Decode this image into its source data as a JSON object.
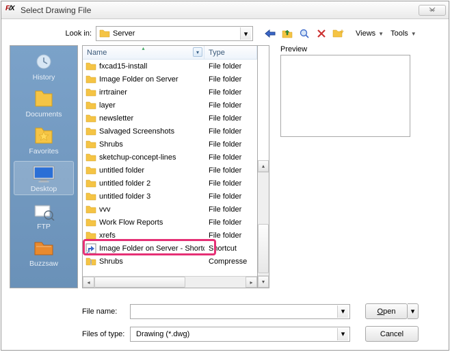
{
  "title": "Select Drawing File",
  "look_in": {
    "label": "Look in:",
    "value": "Server"
  },
  "toolbar_menus": {
    "views": "Views",
    "tools": "Tools"
  },
  "places": [
    {
      "key": "history",
      "label": "History"
    },
    {
      "key": "documents",
      "label": "Documents"
    },
    {
      "key": "favorites",
      "label": "Favorites"
    },
    {
      "key": "desktop",
      "label": "Desktop",
      "selected": true
    },
    {
      "key": "ftp",
      "label": "FTP"
    },
    {
      "key": "buzzsaw",
      "label": "Buzzsaw"
    }
  ],
  "columns": {
    "name": "Name",
    "type": "Type"
  },
  "files": [
    {
      "icon": "folder",
      "name": "fxcad15-install",
      "type": "File folder"
    },
    {
      "icon": "folder",
      "name": "Image Folder on Server",
      "type": "File folder"
    },
    {
      "icon": "folder",
      "name": "irrtrainer",
      "type": "File folder"
    },
    {
      "icon": "folder",
      "name": "layer",
      "type": "File folder"
    },
    {
      "icon": "folder",
      "name": "newsletter",
      "type": "File folder"
    },
    {
      "icon": "folder",
      "name": "Salvaged Screenshots",
      "type": "File folder"
    },
    {
      "icon": "folder",
      "name": "Shrubs",
      "type": "File folder"
    },
    {
      "icon": "folder",
      "name": "sketchup-concept-lines",
      "type": "File folder"
    },
    {
      "icon": "folder",
      "name": "untitled folder",
      "type": "File folder"
    },
    {
      "icon": "folder",
      "name": "untitled folder 2",
      "type": "File folder"
    },
    {
      "icon": "folder",
      "name": "untitled folder 3",
      "type": "File folder"
    },
    {
      "icon": "folder",
      "name": "vvv",
      "type": "File folder"
    },
    {
      "icon": "folder",
      "name": "Work Flow Reports",
      "type": "File folder"
    },
    {
      "icon": "folder",
      "name": "xrefs",
      "type": "File folder"
    },
    {
      "icon": "shortcut",
      "name": "Image Folder on Server - Shortcut",
      "type": "Shortcut",
      "highlight": true
    },
    {
      "icon": "zip",
      "name": "Shrubs",
      "type": "Compresse"
    }
  ],
  "preview_label": "Preview",
  "file_name": {
    "label": "File name:",
    "value": ""
  },
  "file_type": {
    "label": "Files of type:",
    "value": "Drawing (*.dwg)"
  },
  "buttons": {
    "open": "Open",
    "cancel": "Cancel"
  }
}
